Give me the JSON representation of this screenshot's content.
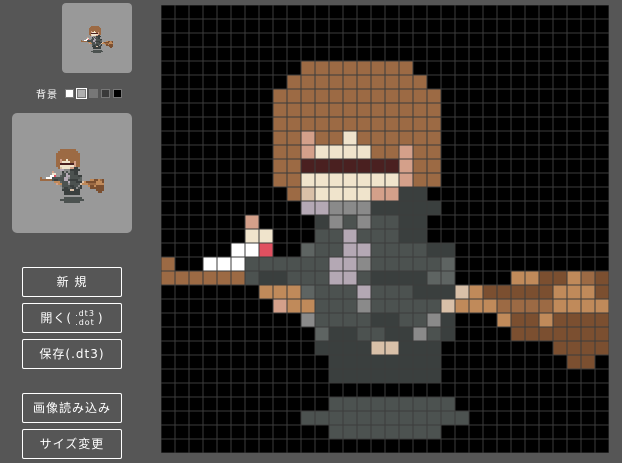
{
  "sidebar": {
    "bg_label": "背景",
    "bg_swatches": [
      {
        "color": "#ffffff",
        "selected": false
      },
      {
        "color": "#b0b0b0",
        "selected": true
      },
      {
        "color": "#777777",
        "selected": false
      },
      {
        "color": "#3a3a3a",
        "selected": false
      },
      {
        "color": "#000000",
        "selected": false
      }
    ],
    "buttons": {
      "new": "新 規",
      "open_prefix": "開く(",
      "open_ext1": ".dt3",
      "open_ext2": ".dot",
      "open_suffix": ")",
      "save": "保存(.dt3)",
      "import": "画像読み込み",
      "resize": "サイズ変更"
    }
  },
  "editor": {
    "grid_cols": 32,
    "grid_rows": 32,
    "background": "#000000",
    "grid_line_color": "#3c3c3c",
    "palette": {
      "A": "#9c6a44",
      "B": "#7b4f30",
      "C": "#c08a5a",
      "D": "#d4a08a",
      "E": "#f0e4cc",
      "F": "#4a2020",
      "G": "#4c5250",
      "H": "#3a3f3e",
      "I": "#8a8a8a",
      "J": "#b4a8b4",
      "K": "#d9c0a8",
      "L": "#ffffff",
      "M": "#e05060",
      "N": "#5e6462"
    },
    "pixels": [
      "................................",
      "................................",
      "................................",
      "................................",
      "..........AAAAAAAA..............",
      ".........AAAAAAAAAA.............",
      "........AAAAAAAAAAAA............",
      "........AAAAAAAAAAAA............",
      "........AAAAAAAAAAAA............",
      "........AADAAEAAAAAA............",
      "........AADEEEEAADAA............",
      "........AAFFFFFFFDAA............",
      "........AAEEEEEEEDAA............",
      ".........AKEEEEDDHH.............",
      "..........JJIIIHHHHH............",
      "......D....HIGIGGHH.............",
      "......EE...GGJGGGHH.............",
      ".....LLM..NGGJJGGGGHH...........",
      "A..LLLGGGGGGJJIGGGGGN...........",
      "AAAAAAGHHGGGJJGHHHHNN....CCBBCAB",
      ".......CCCNGGGJGGGHHHKCBBBBBCCCB",
      "........DCCGGGIGGGGGKCCCAAAACCCC",
      "..........IGGGGHHGGIH...CBBCBBBB",
      "...........NHHGGHHIGH....BBBBBBB",
      "...........HHHHKKHHH........BBBB",
      "............HHHHHHHH.........BB.",
      "............HHHHHHHH............",
      "................................",
      "................................",
      "................................",
      "................................",
      "................................"
    ],
    "shadow_rows": [
      {
        "row": 28,
        "from": 12,
        "to": 20
      },
      {
        "row": 29,
        "from": 10,
        "to": 21
      },
      {
        "row": 30,
        "from": 12,
        "to": 19
      }
    ]
  }
}
